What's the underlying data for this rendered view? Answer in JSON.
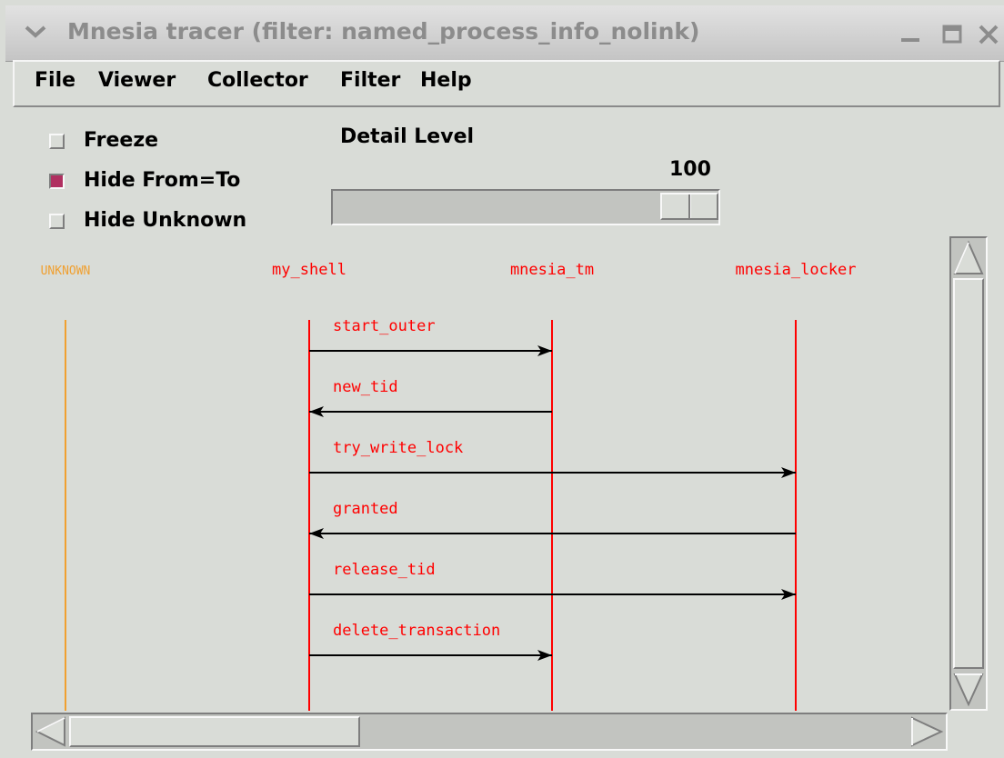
{
  "window": {
    "title": "Mnesia tracer (filter: named_process_info_nolink)",
    "controls": [
      "window-menu-icon",
      "minimize-icon",
      "maximize-icon",
      "close-icon"
    ]
  },
  "menu": [
    "File",
    "Viewer",
    "Collector",
    "Filter",
    "Help"
  ],
  "options": [
    {
      "label": "Freeze",
      "checked": false
    },
    {
      "label": "Hide From=To",
      "checked": true
    },
    {
      "label": "Hide Unknown",
      "checked": false
    }
  ],
  "detail": {
    "label": "Detail Level",
    "value": "100",
    "level": 100,
    "min": 0,
    "max": 100
  },
  "trace": {
    "processes": [
      {
        "name": "UNKNOWN",
        "color": "#f0a030"
      },
      {
        "name": "my_shell",
        "color": "#ff0000"
      },
      {
        "name": "mnesia_tm",
        "color": "#ff0000"
      },
      {
        "name": "mnesia_locker",
        "color": "#ff0000"
      }
    ],
    "messages": [
      {
        "label": "start_outer",
        "from": "my_shell",
        "to": "mnesia_tm"
      },
      {
        "label": "new_tid",
        "from": "mnesia_tm",
        "to": "my_shell"
      },
      {
        "label": "try_write_lock",
        "from": "my_shell",
        "to": "mnesia_locker"
      },
      {
        "label": "granted",
        "from": "mnesia_locker",
        "to": "my_shell"
      },
      {
        "label": "release_tid",
        "from": "my_shell",
        "to": "mnesia_locker"
      },
      {
        "label": "delete_transaction",
        "from": "my_shell",
        "to": "mnesia_tm"
      }
    ],
    "message_color": "#ff0000",
    "arrow_color": "#000000"
  },
  "colors": {
    "window_bg": "#d9dcd7",
    "checked": "#b03060"
  }
}
